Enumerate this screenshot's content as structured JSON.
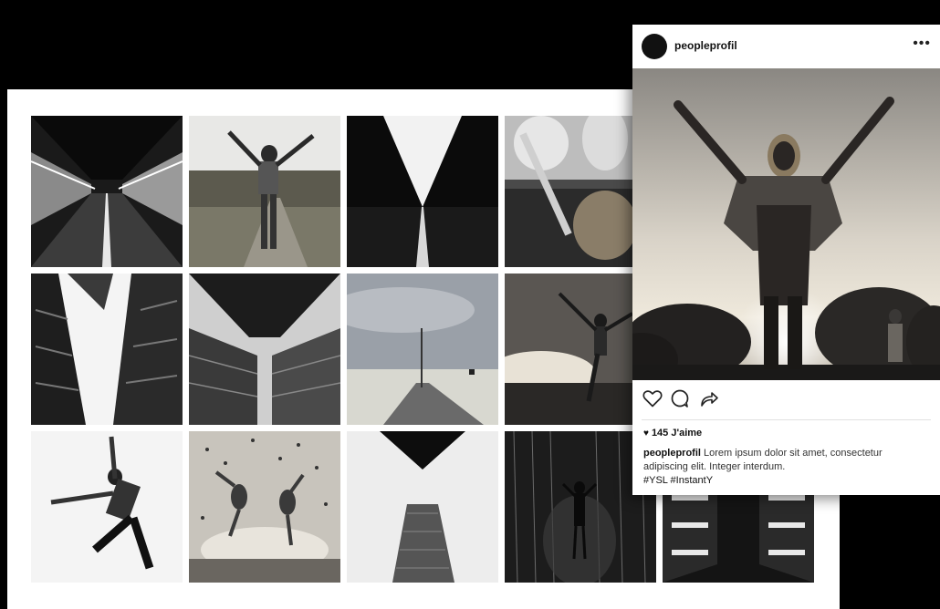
{
  "post": {
    "username": "peopleprofil",
    "likes": "145 J'aime",
    "caption_user": "peopleprofil",
    "caption_text": " Lorem ipsum dolor sit amet, consectetur adipiscing elit. Integer interdum.",
    "hashtags": "#YSL #InstantY"
  },
  "icons": {
    "more": "more-options-icon",
    "like": "heart-icon",
    "comment": "comment-icon",
    "share": "share-icon"
  },
  "colors": {
    "background": "#000000",
    "panel": "#ffffff",
    "text": "#111111"
  }
}
